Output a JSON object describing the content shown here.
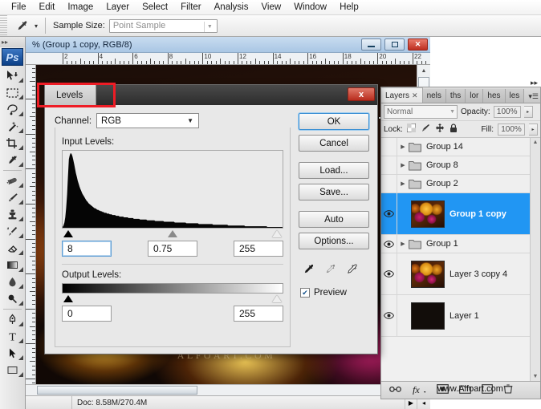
{
  "menubar": {
    "items": [
      "File",
      "Edit",
      "Image",
      "Layer",
      "Select",
      "Filter",
      "Analysis",
      "View",
      "Window",
      "Help"
    ]
  },
  "options_bar": {
    "tool_icon": "eyedropper-icon",
    "sample_size_label": "Sample Size:",
    "sample_size_value": "Point Sample"
  },
  "toolbox": {
    "logo": "Ps",
    "tools": [
      "move-tool-icon",
      "marquee-tool-icon",
      "lasso-tool-icon",
      "magic-wand-tool-icon",
      "crop-tool-icon",
      "eyedropper-tool-icon",
      "healing-brush-tool-icon",
      "brush-tool-icon",
      "clone-stamp-tool-icon",
      "history-brush-tool-icon",
      "eraser-tool-icon",
      "gradient-tool-icon",
      "blur-tool-icon",
      "dodge-tool-icon",
      "pen-tool-icon",
      "type-tool-icon",
      "path-selection-tool-icon",
      "shape-tool-icon"
    ]
  },
  "document": {
    "title": "% (Group 1 copy, RGB/8)",
    "ruler_labels": [
      "2",
      "4",
      "6",
      "8",
      "10",
      "12",
      "14",
      "16",
      "18",
      "20",
      "22"
    ],
    "canvas_watermark": "ALFOART.COM",
    "window_buttons": [
      "minimize-button",
      "restore-button",
      "close-button"
    ]
  },
  "statusbar": {
    "zoom": "",
    "doc_info": "Doc: 8.58M/270.4M"
  },
  "layers_panel": {
    "tabs": [
      {
        "label": "Layers",
        "closable": true,
        "active": true
      },
      {
        "label": "nels",
        "closable": false,
        "active": false
      },
      {
        "label": "ths",
        "closable": false,
        "active": false
      },
      {
        "label": "lor",
        "closable": false,
        "active": false
      },
      {
        "label": "hes",
        "closable": false,
        "active": false
      },
      {
        "label": "les",
        "closable": false,
        "active": false
      }
    ],
    "blend_mode": "Normal",
    "opacity_label": "Opacity:",
    "opacity_value": "100%",
    "lock_label": "Lock:",
    "fill_label": "Fill:",
    "fill_value": "100%",
    "lock_icons": [
      "lock-transparent-icon",
      "lock-image-icon",
      "lock-position-icon",
      "lock-all-icon"
    ],
    "layers": [
      {
        "name": "Group 14",
        "type": "group",
        "visible": false,
        "selected": false,
        "thumb": null
      },
      {
        "name": "Group 8",
        "type": "group",
        "visible": false,
        "selected": false,
        "thumb": null
      },
      {
        "name": "Group 2",
        "type": "group",
        "visible": false,
        "selected": false,
        "thumb": null
      },
      {
        "name": "Group 1 copy",
        "type": "layer",
        "visible": true,
        "selected": true,
        "thumb": "flowers"
      },
      {
        "name": "Group 1",
        "type": "group",
        "visible": true,
        "selected": false,
        "thumb": null
      },
      {
        "name": "Layer 3 copy 4",
        "type": "layer",
        "visible": true,
        "selected": false,
        "thumb": "flowers"
      },
      {
        "name": "Layer 1",
        "type": "layer",
        "visible": true,
        "selected": false,
        "thumb": "black"
      }
    ],
    "footer_icons": [
      "link-layers-icon",
      "layer-style-fx-icon",
      "add-mask-icon",
      "new-group-icon",
      "new-layer-icon",
      "delete-layer-icon"
    ],
    "footer_watermark": "www.Alfoart.com"
  },
  "levels_dialog": {
    "title": "Levels",
    "close_label": "x",
    "channel_label": "Channel:",
    "channel_value": "RGB",
    "input_levels_label": "Input Levels:",
    "input_black": "8",
    "input_gamma": "0.75",
    "input_white": "255",
    "output_levels_label": "Output Levels:",
    "output_black": "0",
    "output_white": "255",
    "buttons": [
      {
        "label": "OK",
        "primary": true
      },
      {
        "label": "Cancel",
        "primary": false
      },
      {
        "label": "Load...",
        "primary": false
      },
      {
        "label": "Save...",
        "primary": false
      },
      {
        "label": "Auto",
        "primary": false
      },
      {
        "label": "Options...",
        "primary": false
      }
    ],
    "eyedroppers": [
      "set-black-point-icon",
      "set-gray-point-icon",
      "set-white-point-icon"
    ],
    "preview_label": "Preview",
    "preview_checked": true,
    "check_glyph": "✔",
    "histogram": [
      1,
      3,
      7,
      14,
      26,
      44,
      68,
      92,
      97,
      100,
      99,
      96,
      91,
      85,
      79,
      73,
      68,
      63,
      59,
      55,
      52,
      49,
      46,
      44,
      42,
      40,
      38,
      36,
      35,
      33,
      32,
      31,
      30,
      29,
      28,
      27,
      26,
      26,
      25,
      24,
      24,
      23,
      23,
      22,
      22,
      21,
      21,
      20,
      20,
      20,
      19,
      19,
      19,
      18,
      18,
      18,
      17,
      17,
      17,
      17,
      16,
      16,
      16,
      16,
      15,
      15,
      15,
      15,
      15,
      14,
      14,
      14,
      14,
      14,
      13,
      13,
      13,
      13,
      13,
      13,
      12,
      12,
      12,
      12,
      12,
      12,
      12,
      11,
      11,
      11,
      11,
      11,
      11,
      11,
      11,
      10,
      10,
      10,
      10,
      10,
      10,
      10,
      10,
      10,
      9,
      9,
      9,
      9,
      9,
      9,
      9,
      9,
      9,
      9,
      8,
      8,
      8,
      8,
      8,
      8,
      8,
      8,
      8,
      8,
      8,
      8,
      7,
      7,
      7,
      7,
      7,
      7,
      7,
      7,
      7,
      7,
      7,
      7,
      7,
      6,
      6,
      6,
      6,
      6,
      6,
      6,
      6,
      6,
      6,
      6,
      6,
      6,
      6,
      5,
      5,
      5,
      5,
      5,
      5,
      5,
      5,
      5,
      5,
      5,
      5,
      5,
      5,
      5,
      5,
      4,
      4,
      4,
      4,
      4,
      4,
      4,
      4,
      4,
      4,
      4,
      4,
      4,
      4,
      4,
      4,
      4,
      3,
      3,
      3,
      3,
      3,
      3,
      3,
      3,
      3,
      3,
      3,
      3,
      3,
      3,
      3,
      3,
      3,
      3,
      3,
      2,
      2,
      2,
      2,
      2,
      2,
      2,
      2,
      2,
      2,
      2,
      2,
      2,
      2,
      2,
      2,
      2,
      2,
      2,
      2,
      2,
      2,
      2,
      2,
      2,
      1,
      1,
      1,
      1,
      1,
      1,
      1,
      1,
      1,
      1,
      1,
      1,
      1,
      1,
      1,
      1,
      1,
      1
    ]
  },
  "annotation": {
    "color": "#ee1c25",
    "shape": "rectangle-highlight"
  }
}
